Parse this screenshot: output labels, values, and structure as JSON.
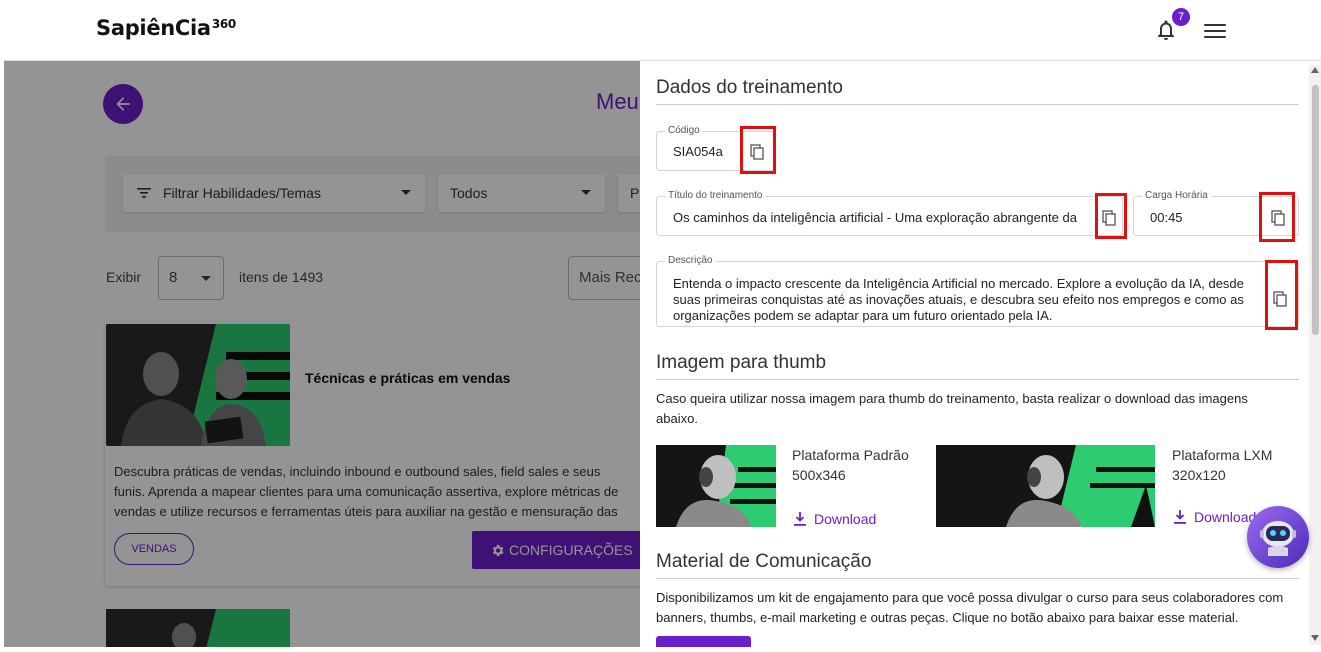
{
  "header": {
    "logo_text": "SapiênCia",
    "logo_suffix": "360",
    "notification_count": "7"
  },
  "background_page": {
    "title": "Meu",
    "filters": {
      "skills": "Filtrar Habilidades/Temas",
      "status": "Todos",
      "third": "P"
    },
    "pagination": {
      "show_label": "Exibir",
      "per_page": "8",
      "items_label": "itens de 1493",
      "sort": "Mais Rec"
    },
    "course": {
      "title": "Técnicas e práticas em vendas",
      "desc_line1": "Descubra práticas de vendas, incluindo inbound e outbound sales, field sales e seus",
      "desc_line2": "funis. Aprenda a mapear clientes para uma comunicação assertiva, explore métricas de",
      "desc_line3": "vendas e utilize recursos e ferramentas úteis para auxiliar na gestão e mensuração das",
      "tag": "VENDAS",
      "config_button": "CONFIGURAÇÕES"
    }
  },
  "drawer": {
    "training_section": {
      "title": "Dados do treinamento",
      "code_label": "Código",
      "code_value": "SIA054a",
      "title_label": "Título do treinamento",
      "title_value": "Os caminhos da inteligência artificial - Uma exploração abrangente da",
      "hours_label": "Carga Horária",
      "hours_value": "00:45",
      "description_label": "Descrição",
      "description_value": "Entenda o impacto crescente da Inteligência Artificial no mercado. Explore a evolução da IA, desde suas primeiras conquistas até as inovações atuais, e descubra seu efeito nos empregos e como as organizações podem se adaptar para um futuro orientado pela IA."
    },
    "thumb_section": {
      "title": "Imagem para thumb",
      "text": "Caso queira utilizar nossa imagem para thumb do treinamento, basta realizar o download das imagens abaixo.",
      "standard": {
        "name": "Plataforma Padrão",
        "size": "500x346",
        "download": "Download"
      },
      "lxm": {
        "name": "Plataforma LXM",
        "size": "320x120",
        "download": "Download"
      }
    },
    "material_section": {
      "title": "Material de Comunicação",
      "text": "Disponibilizamos um kit de engajamento para que você possa divulgar o curso para seus colaboradores com banners, thumbs, e-mail marketing e outras peças. Clique no botão abaixo para baixar esse material."
    }
  },
  "colors": {
    "accent": "#6a1fc9",
    "highlight": "#e01010"
  }
}
